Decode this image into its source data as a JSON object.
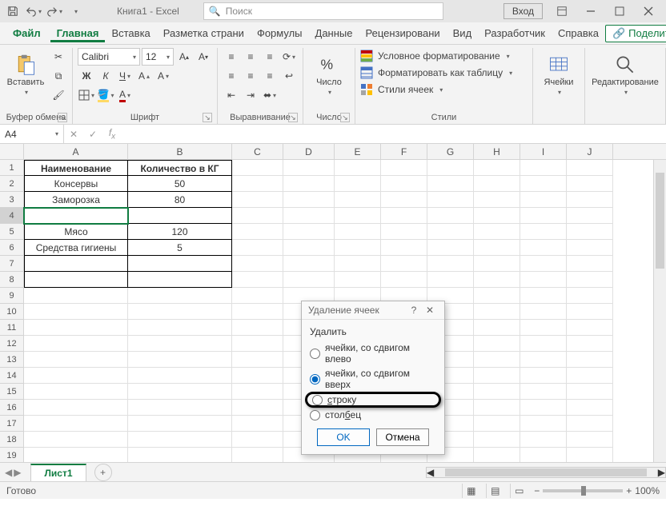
{
  "title": "Книга1 - Excel",
  "search_placeholder": "Поиск",
  "login": "Вход",
  "file_tab": "Файл",
  "tabs": [
    "Главная",
    "Вставка",
    "Разметка страни",
    "Формулы",
    "Данные",
    "Рецензировани",
    "Вид",
    "Разработчик",
    "Справка"
  ],
  "share": "Поделиться",
  "ribbon": {
    "paste": "Вставить",
    "clipboard": "Буфер обмена",
    "font_name": "Calibri",
    "font_size": "12",
    "font": "Шрифт",
    "align": "Выравнивание",
    "number_btn": "Число",
    "number": "Число",
    "cond": "Условное форматирование",
    "table": "Форматировать как таблицу",
    "cell_styles": "Стили ячеек",
    "styles": "Стили",
    "cells": "Ячейки",
    "editing": "Редактирование"
  },
  "namebox": "A4",
  "colheads": [
    "A",
    "B",
    "C",
    "D",
    "E",
    "F",
    "G",
    "H",
    "I",
    "J"
  ],
  "rowcount": 19,
  "data": {
    "A1": "Наименование",
    "B1": "Количество в КГ",
    "A2": "Консервы",
    "B2": "50",
    "A3": "Заморозка",
    "B3": "80",
    "A5": "Мясо",
    "B5": "120",
    "A6": "Средства гигиены",
    "B6": "5"
  },
  "dialog": {
    "title": "Удаление ячеек",
    "group": "Удалить",
    "opts": [
      "ячейки, со сдвигом влево",
      "ячейки, со сдвигом вверх",
      "строку",
      "столбец"
    ],
    "ok": "OK",
    "cancel": "Отмена"
  },
  "sheet": "Лист1",
  "status": "Готово",
  "zoom": "100%"
}
